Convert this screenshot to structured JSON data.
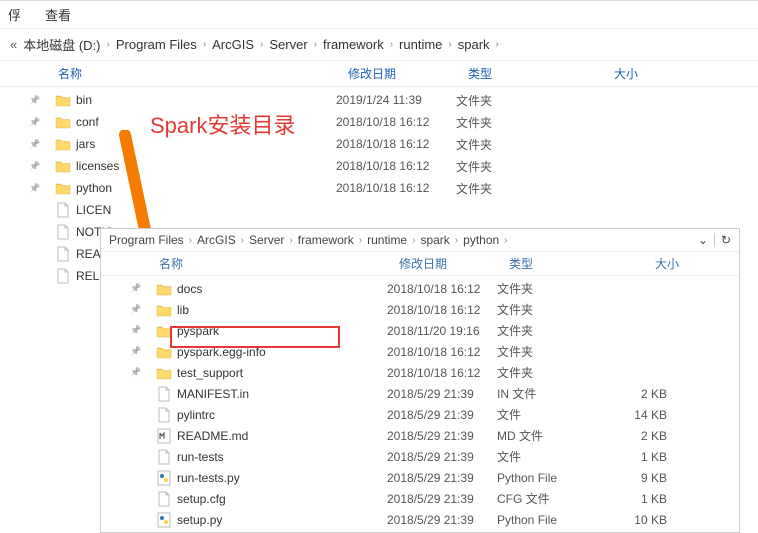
{
  "menu": {
    "share": "俘",
    "view": "查看"
  },
  "breadcrumb1": {
    "back_chev": "«",
    "items": [
      "本地磁盘 (D:)",
      "Program Files",
      "ArcGIS",
      "Server",
      "framework",
      "runtime",
      "spark"
    ]
  },
  "columns": {
    "name": "名称",
    "date": "修改日期",
    "type": "类型",
    "size": "大小"
  },
  "annotation_text": "Spark安装目录",
  "files1": [
    {
      "pin": true,
      "icon": "folder",
      "name": "bin",
      "date": "2019/1/24 11:39",
      "type": "文件夹",
      "size": ""
    },
    {
      "pin": true,
      "icon": "folder",
      "name": "conf",
      "date": "2018/10/18 16:12",
      "type": "文件夹",
      "size": ""
    },
    {
      "pin": true,
      "icon": "folder",
      "name": "jars",
      "date": "2018/10/18 16:12",
      "type": "文件夹",
      "size": ""
    },
    {
      "pin": true,
      "icon": "folder",
      "name": "licenses",
      "date": "2018/10/18 16:12",
      "type": "文件夹",
      "size": ""
    },
    {
      "pin": true,
      "icon": "folder",
      "name": "python",
      "date": "2018/10/18 16:12",
      "type": "文件夹",
      "size": ""
    },
    {
      "pin": false,
      "icon": "file",
      "name": "LICEN",
      "date": "",
      "type": "",
      "size": ""
    },
    {
      "pin": false,
      "icon": "file",
      "name": "NOTIC",
      "date": "",
      "type": "",
      "size": ""
    },
    {
      "pin": false,
      "icon": "file",
      "name": "READM",
      "date": "",
      "type": "",
      "size": ""
    },
    {
      "pin": false,
      "icon": "file",
      "name": "RELEAS",
      "date": "",
      "type": "",
      "size": ""
    }
  ],
  "breadcrumb2": {
    "items": [
      "Program Files",
      "ArcGIS",
      "Server",
      "framework",
      "runtime",
      "spark",
      "python"
    ]
  },
  "files2": [
    {
      "pin": true,
      "icon": "folder",
      "name": "docs",
      "date": "2018/10/18 16:12",
      "type": "文件夹",
      "size": ""
    },
    {
      "pin": true,
      "icon": "folder",
      "name": "lib",
      "date": "2018/10/18 16:12",
      "type": "文件夹",
      "size": ""
    },
    {
      "pin": true,
      "icon": "folder",
      "name": "pyspark",
      "date": "2018/11/20 19:16",
      "type": "文件夹",
      "size": ""
    },
    {
      "pin": true,
      "icon": "folder",
      "name": "pyspark.egg-info",
      "date": "2018/10/18 16:12",
      "type": "文件夹",
      "size": ""
    },
    {
      "pin": true,
      "icon": "folder",
      "name": "test_support",
      "date": "2018/10/18 16:12",
      "type": "文件夹",
      "size": ""
    },
    {
      "pin": false,
      "icon": "file",
      "name": "MANIFEST.in",
      "date": "2018/5/29 21:39",
      "type": "IN 文件",
      "size": "2 KB"
    },
    {
      "pin": false,
      "icon": "file",
      "name": "pylintrc",
      "date": "2018/5/29 21:39",
      "type": "文件",
      "size": "14 KB"
    },
    {
      "pin": false,
      "icon": "md",
      "name": "README.md",
      "date": "2018/5/29 21:39",
      "type": "MD 文件",
      "size": "2 KB"
    },
    {
      "pin": false,
      "icon": "file",
      "name": "run-tests",
      "date": "2018/5/29 21:39",
      "type": "文件",
      "size": "1 KB"
    },
    {
      "pin": false,
      "icon": "py",
      "name": "run-tests.py",
      "date": "2018/5/29 21:39",
      "type": "Python File",
      "size": "9 KB"
    },
    {
      "pin": false,
      "icon": "file",
      "name": "setup.cfg",
      "date": "2018/5/29 21:39",
      "type": "CFG 文件",
      "size": "1 KB"
    },
    {
      "pin": false,
      "icon": "py",
      "name": "setup.py",
      "date": "2018/5/29 21:39",
      "type": "Python File",
      "size": "10 KB"
    }
  ]
}
